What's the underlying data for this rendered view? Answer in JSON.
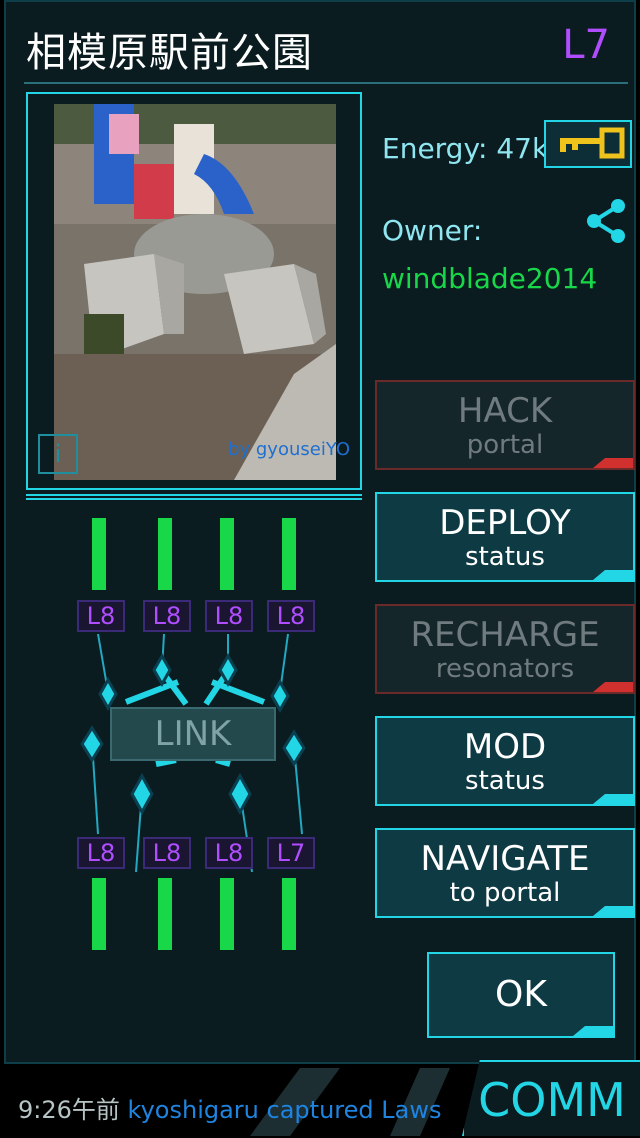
{
  "portal": {
    "title": "相模原駅前公園",
    "level": "L7",
    "photo_credit": "by gyouseiYO",
    "info_label": "i"
  },
  "details": {
    "energy_label": "Energy:",
    "energy_value": "47k",
    "owner_label": "Owner:",
    "owner_name": "windblade2014"
  },
  "actions": [
    {
      "title": "HACK",
      "subtitle": "portal",
      "enabled": false
    },
    {
      "title": "DEPLOY",
      "subtitle": "status",
      "enabled": true
    },
    {
      "title": "RECHARGE",
      "subtitle": "resonators",
      "enabled": false
    },
    {
      "title": "MOD",
      "subtitle": "status",
      "enabled": true
    },
    {
      "title": "NAVIGATE",
      "subtitle": "to portal",
      "enabled": true
    }
  ],
  "ok_label": "OK",
  "link_label": "LINK",
  "resonators_top": [
    "L8",
    "L8",
    "L8",
    "L8"
  ],
  "resonators_bottom": [
    "L8",
    "L8",
    "L8",
    "L7"
  ],
  "comm": {
    "time": "9:26午前",
    "user": "kyoshigaru",
    "text": "captured Laws",
    "button_label": "COMM"
  },
  "colors": {
    "accent": "#22d6e6",
    "owner_green": "#18d84a",
    "level_purple": "#b04dff",
    "disabled_red": "#d0302e"
  }
}
